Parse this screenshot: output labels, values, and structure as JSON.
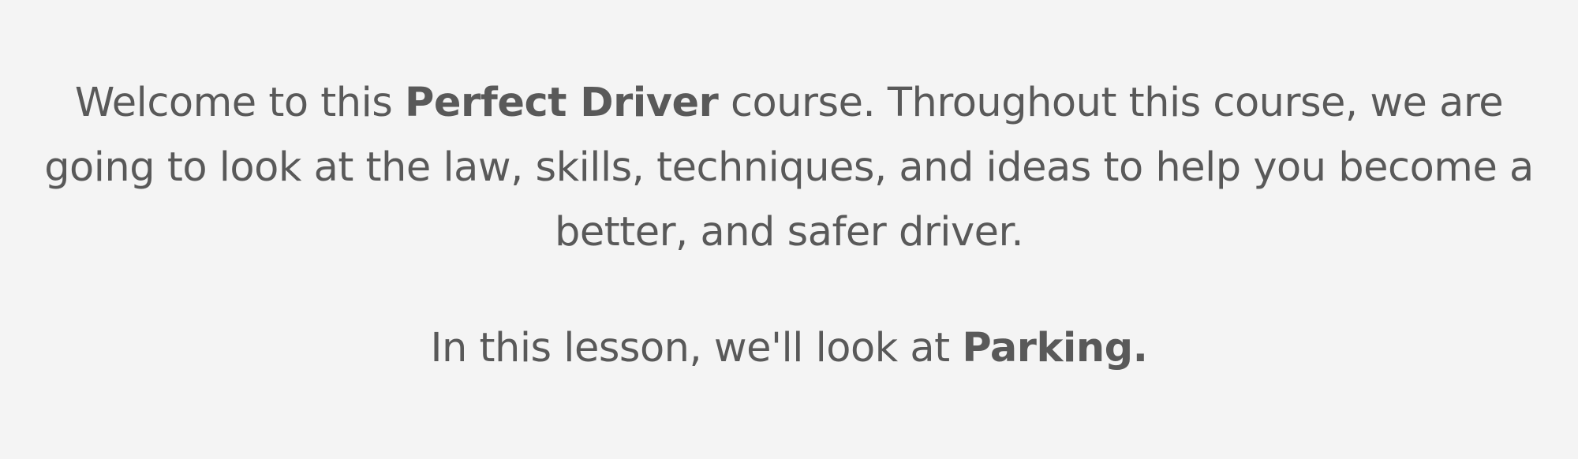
{
  "intro": {
    "before": "Welcome to this ",
    "course_name": "Perfect Driver",
    "after": " course. Throughout this course, we are going to look at the law, skills, techniques, and ideas to help you become a better, and safer driver."
  },
  "lesson": {
    "before": "In this lesson, we'll look at ",
    "topic": "Parking."
  },
  "colors": {
    "background": "#f4f4f4",
    "text": "#595959"
  }
}
